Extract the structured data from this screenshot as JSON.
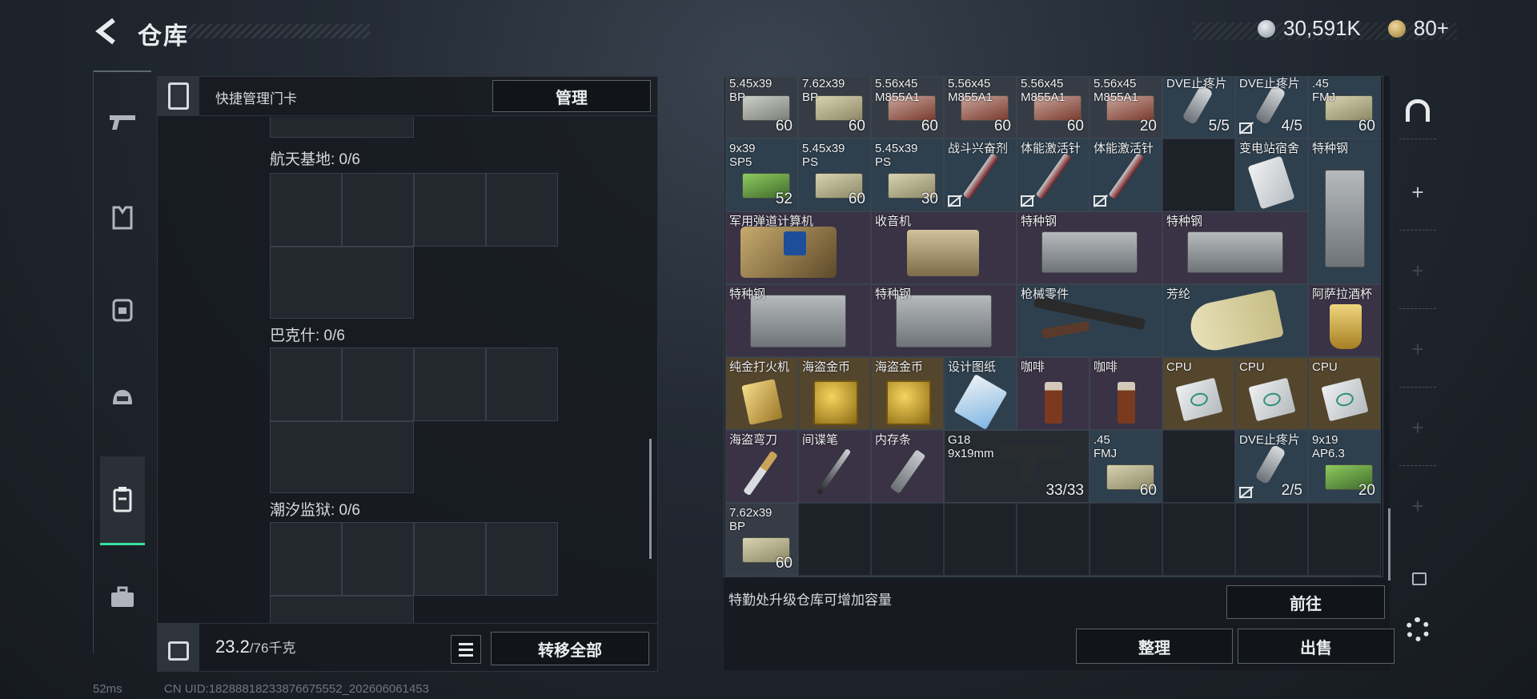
{
  "header": {
    "title": "仓库",
    "currency_primary": "30,591K",
    "currency_secondary": "80+"
  },
  "left_panel": {
    "keycard_label": "快捷管理门卡",
    "manage_button": "管理",
    "regions": [
      {
        "label": "航天基地: 0/6"
      },
      {
        "label": "巴克什: 0/6"
      },
      {
        "label": "潮汐监狱: 0/6"
      }
    ],
    "weight_value": "23.2",
    "weight_max": "/76千克",
    "transfer_all_button": "转移全部"
  },
  "stash": {
    "items": [
      {
        "name": "5.45x39\nBP",
        "qty": "60"
      },
      {
        "name": "7.62x39\nBP",
        "qty": "60"
      },
      {
        "name": "5.56x45\nM855A1",
        "qty": "60"
      },
      {
        "name": "5.56x45\nM855A1",
        "qty": "60"
      },
      {
        "name": "5.56x45\nM855A1",
        "qty": "60"
      },
      {
        "name": "5.56x45\nM855A1",
        "qty": "20"
      },
      {
        "name": "DVE止疼片",
        "qty": "5/5"
      },
      {
        "name": "DVE止疼片",
        "qty": "4/5"
      },
      {
        "name": ".45\nFMJ",
        "qty": "60"
      },
      {
        "name": "9x39\nSP5",
        "qty": "52"
      },
      {
        "name": "5.45x39\nPS",
        "qty": "60"
      },
      {
        "name": "5.45x39\nPS",
        "qty": "30"
      },
      {
        "name": "战斗兴奋剂",
        "qty": ""
      },
      {
        "name": "体能激活针",
        "qty": ""
      },
      {
        "name": "体能激活针",
        "qty": ""
      },
      {
        "name": "变电站宿舍",
        "qty": ""
      },
      {
        "name": "特种钢",
        "qty": ""
      },
      {
        "name": "军用弹道计算机",
        "qty": ""
      },
      {
        "name": "收音机",
        "qty": ""
      },
      {
        "name": "特种钢",
        "qty": ""
      },
      {
        "name": "特种钢",
        "qty": ""
      },
      {
        "name": "特种钢",
        "qty": ""
      },
      {
        "name": "特种钢",
        "qty": ""
      },
      {
        "name": "枪械零件",
        "qty": ""
      },
      {
        "name": "芳纶",
        "qty": ""
      },
      {
        "name": "阿萨拉酒杯",
        "qty": ""
      },
      {
        "name": "纯金打火机",
        "qty": ""
      },
      {
        "name": "海盗金币",
        "qty": ""
      },
      {
        "name": "海盗金币",
        "qty": ""
      },
      {
        "name": "设计图纸",
        "qty": ""
      },
      {
        "name": "咖啡",
        "qty": ""
      },
      {
        "name": "咖啡",
        "qty": ""
      },
      {
        "name": "CPU",
        "qty": ""
      },
      {
        "name": "CPU",
        "qty": ""
      },
      {
        "name": "CPU",
        "qty": ""
      },
      {
        "name": "海盗弯刀",
        "qty": ""
      },
      {
        "name": "间谍笔",
        "qty": ""
      },
      {
        "name": "内存条",
        "qty": ""
      },
      {
        "name": "G18\n9x19mm",
        "qty": "33/33"
      },
      {
        "name": ".45\nFMJ",
        "qty": "60"
      },
      {
        "name": "DVE止疼片",
        "qty": "2/5"
      },
      {
        "name": "9x19\nAP6.3",
        "qty": "20"
      },
      {
        "name": "7.62x39\nBP",
        "qty": "60"
      }
    ],
    "upgrade_hint": "特勤处升级仓库可增加容量",
    "goto_button": "前往",
    "sort_button": "整理",
    "sell_button": "出售"
  },
  "status_bar": {
    "ping": "52ms",
    "uid": "CN UID:1828881823387667555​2_202606061453"
  }
}
